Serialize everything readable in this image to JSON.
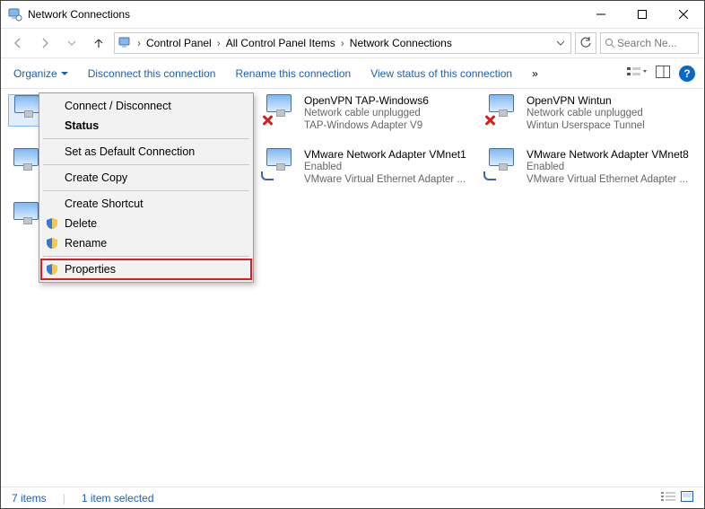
{
  "window": {
    "title": "Network Connections"
  },
  "breadcrumb": {
    "items": [
      "Control Panel",
      "All Control Panel Items",
      "Network Connections"
    ]
  },
  "search": {
    "placeholder": "Search Ne..."
  },
  "commandbar": {
    "organize": "Organize",
    "disconnect": "Disconnect this connection",
    "rename": "Rename this connection",
    "viewstatus": "View status of this connection"
  },
  "adapters": {
    "col2": {
      "a": {
        "name": "OpenVPN TAP-Windows6",
        "status": "Network cable unplugged",
        "device": "TAP-Windows Adapter V9"
      },
      "b": {
        "name": "VMware Network Adapter VMnet1",
        "status": "Enabled",
        "device": "VMware Virtual Ethernet Adapter ..."
      }
    },
    "col3": {
      "a": {
        "name": "OpenVPN Wintun",
        "status": "Network cable unplugged",
        "device": "Wintun Userspace Tunnel"
      },
      "b": {
        "name": "VMware Network Adapter VMnet8",
        "status": "Enabled",
        "device": "VMware Virtual Ethernet Adapter ..."
      }
    }
  },
  "context_menu": {
    "connect": "Connect / Disconnect",
    "status": "Status",
    "set_default": "Set as Default Connection",
    "create_copy": "Create Copy",
    "create_shortcut": "Create Shortcut",
    "delete": "Delete",
    "rename": "Rename",
    "properties": "Properties"
  },
  "statusbar": {
    "count": "7 items",
    "selected": "1 item selected"
  },
  "help": {
    "glyph": "?"
  }
}
